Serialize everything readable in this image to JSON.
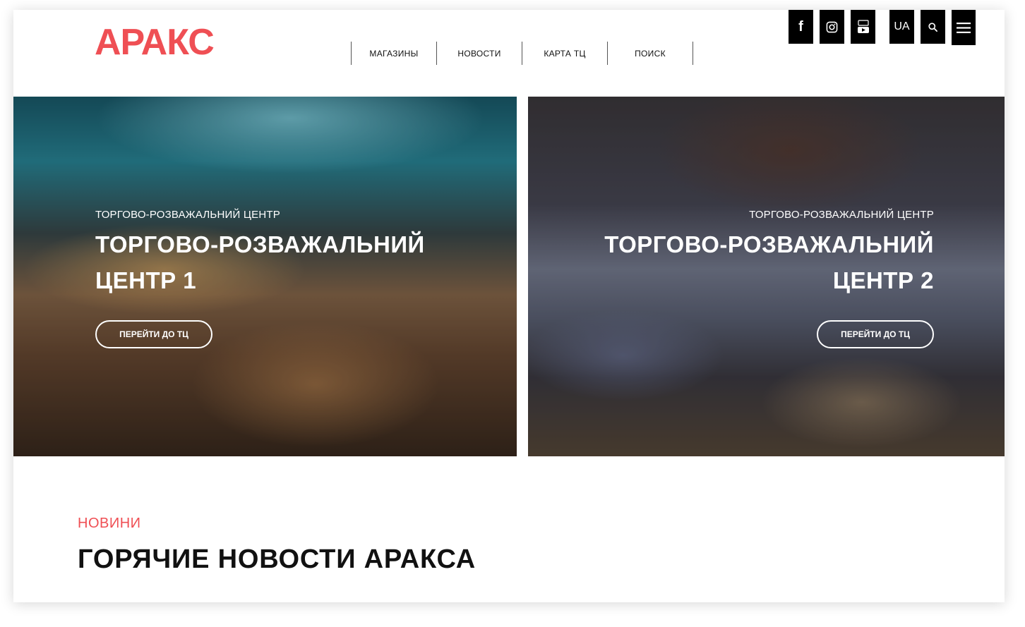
{
  "logo": {
    "text": "АРАКС"
  },
  "nav": {
    "items": [
      "МАГАЗИНЫ",
      "НОВОСТИ",
      "КАРТА ТЦ",
      "ПОИСК"
    ]
  },
  "tools": {
    "facebook": "f",
    "lang": "UA"
  },
  "hero": [
    {
      "eyebrow": "ТОРГОВО-РОЗВАЖАЛЬНИЙ ЦЕНТР",
      "title_line1": "ТОРГОВО-РОЗВАЖАЛЬНИЙ",
      "title_line2": "ЦЕНТР 1",
      "button": "ПЕРЕЙТИ ДО ТЦ"
    },
    {
      "eyebrow": "ТОРГОВО-РОЗВАЖАЛЬНИЙ ЦЕНТР",
      "title_line1": "ТОРГОВО-РОЗВАЖАЛЬНИЙ",
      "title_line2": "ЦЕНТР 2",
      "button": "ПЕРЕЙТИ ДО ТЦ"
    }
  ],
  "news": {
    "eyebrow": "НОВИНИ",
    "title": "ГОРЯЧИЕ НОВОСТИ АРАКСА"
  },
  "colors": {
    "accent": "#ef4f54",
    "dark": "#000000"
  }
}
